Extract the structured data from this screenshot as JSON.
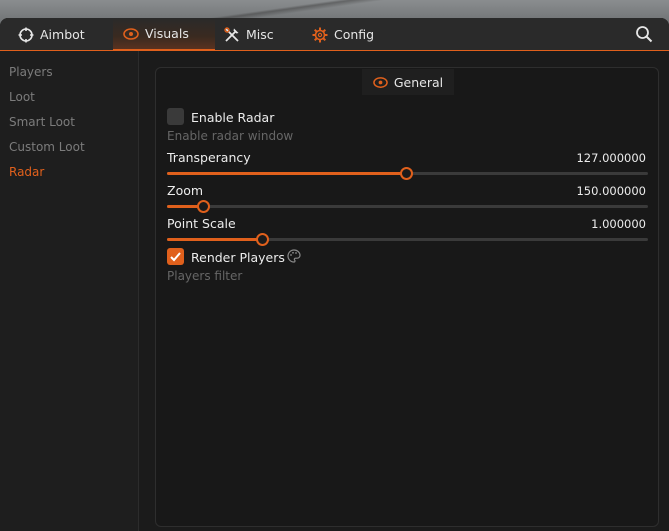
{
  "tabs": {
    "aimbot": "Aimbot",
    "visuals": "Visuals",
    "misc": "Misc",
    "config": "Config"
  },
  "accent_color": "#e0601c",
  "sidebar": {
    "items": [
      "Players",
      "Loot",
      "Smart Loot",
      "Custom Loot",
      "Radar"
    ],
    "active": "Radar"
  },
  "panel": {
    "title": "General",
    "enable_radar": {
      "label": "Enable Radar",
      "checked": false,
      "hint": "Enable radar window"
    },
    "transparency": {
      "label": "Transperancy",
      "value": "127.000000",
      "fraction": 0.497
    },
    "zoom": {
      "label": "Zoom",
      "value": "150.000000",
      "fraction": 0.074
    },
    "point_scale": {
      "label": "Point Scale",
      "value": "1.000000",
      "fraction": 0.198
    },
    "render_players": {
      "label": "Render Players",
      "checked": true
    },
    "players_filter": "Players filter"
  }
}
